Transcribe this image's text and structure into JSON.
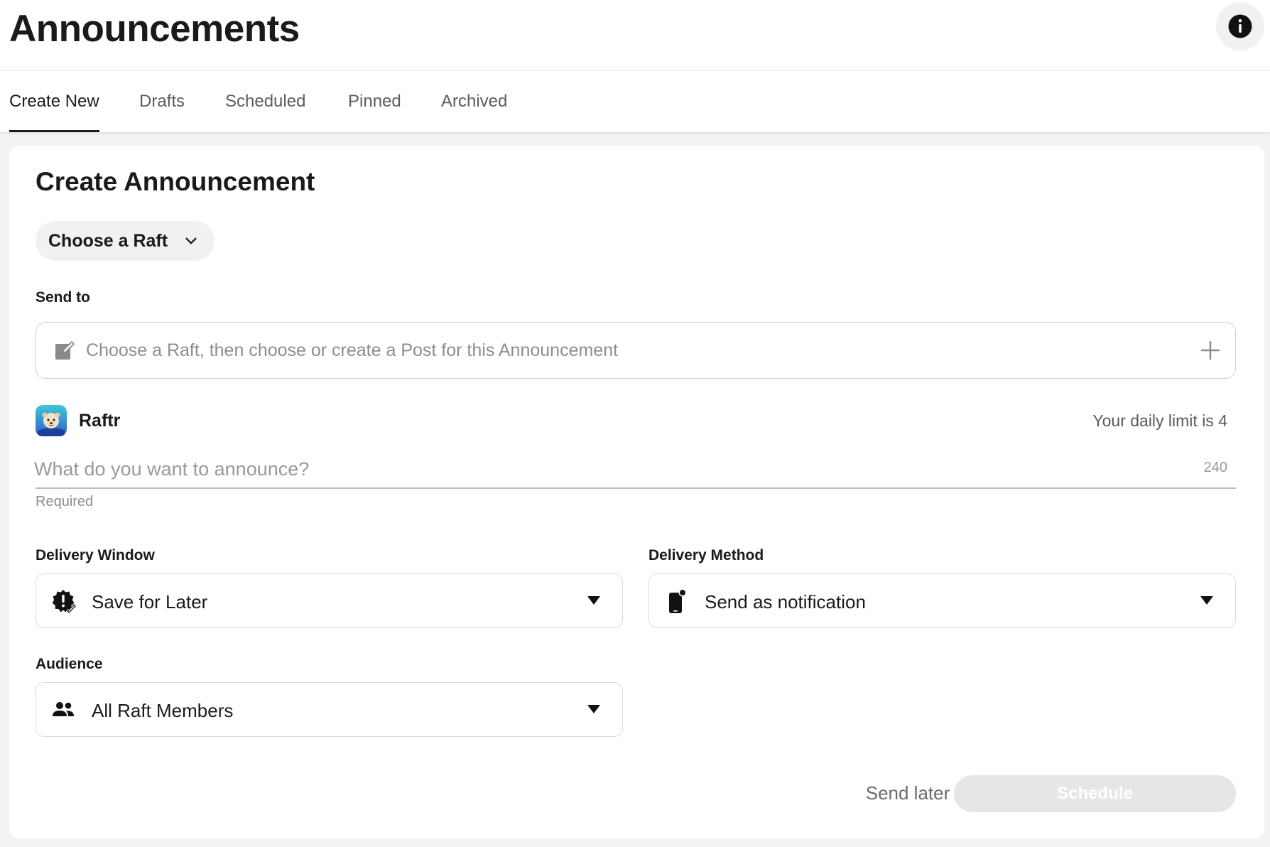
{
  "header": {
    "title": "Announcements"
  },
  "tabs": [
    {
      "label": "Create New",
      "active": true
    },
    {
      "label": "Drafts",
      "active": false
    },
    {
      "label": "Scheduled",
      "active": false
    },
    {
      "label": "Pinned",
      "active": false
    },
    {
      "label": "Archived",
      "active": false
    }
  ],
  "form": {
    "title": "Create Announcement",
    "raft_select_label": "Choose a Raft",
    "send_to": {
      "label": "Send to",
      "placeholder": "Choose a Raft, then choose or create a Post for this Announcement",
      "value": ""
    },
    "raft": {
      "name": "Raftr",
      "daily_limit_text": "Your daily limit is 4"
    },
    "announcement": {
      "placeholder": "What do you want to announce?",
      "value": "",
      "char_limit": "240",
      "helper": "Required"
    },
    "delivery_window": {
      "label": "Delivery Window",
      "selected": "Save for Later",
      "icon": "badge-alert-icon"
    },
    "delivery_method": {
      "label": "Delivery Method",
      "selected": "Send as notification",
      "icon": "phone-notification-icon"
    },
    "audience": {
      "label": "Audience",
      "selected": "All Raft Members",
      "icon": "people-icon"
    },
    "actions": {
      "send_later": "Send later",
      "schedule": "Schedule"
    }
  },
  "colors": {
    "text": "#1a1a1a",
    "muted": "#8d8d8d",
    "disabled_button": "#e6e6e6",
    "page_background": "#f3f3f3"
  }
}
